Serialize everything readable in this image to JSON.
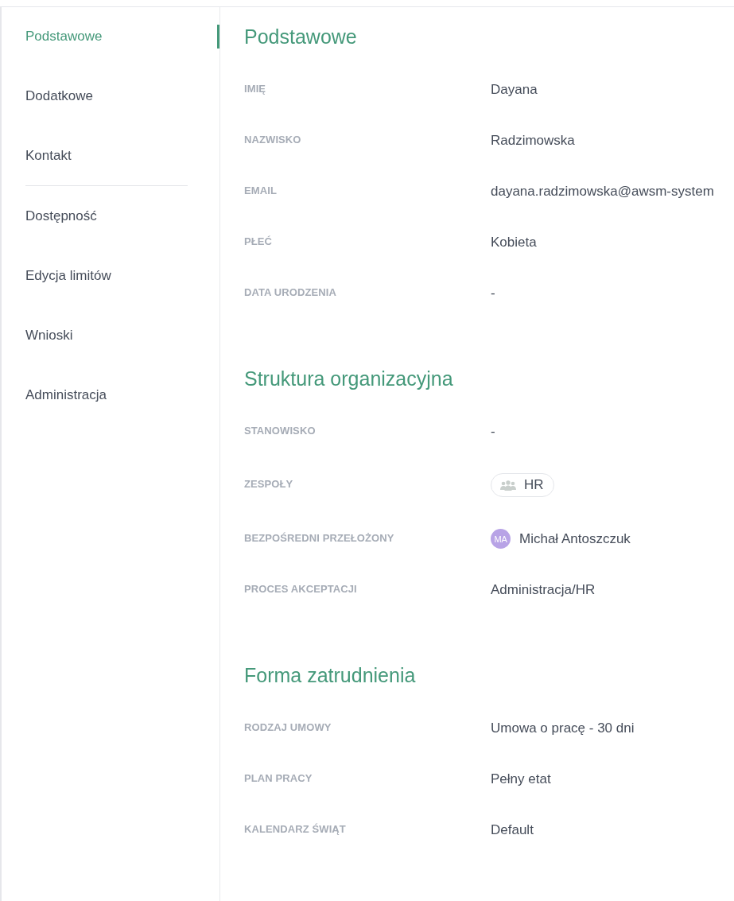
{
  "sidebar": {
    "groups": [
      {
        "items": [
          {
            "label": "Podstawowe",
            "selected": true
          },
          {
            "label": "Dodatkowe",
            "selected": false
          },
          {
            "label": "Kontakt",
            "selected": false
          }
        ]
      },
      {
        "items": [
          {
            "label": "Dostępność",
            "selected": false
          },
          {
            "label": "Edycja limitów",
            "selected": false
          },
          {
            "label": "Wnioski",
            "selected": false
          },
          {
            "label": "Administracja",
            "selected": false
          }
        ]
      }
    ]
  },
  "sections": [
    {
      "title": "Podstawowe",
      "fields": [
        {
          "kind": "text",
          "label": "IMIĘ",
          "value": "Dayana"
        },
        {
          "kind": "text",
          "label": "NAZWISKO",
          "value": "Radzimowska"
        },
        {
          "kind": "text",
          "label": "EMAIL",
          "value": "dayana.radzimowska@awsm-system"
        },
        {
          "kind": "text",
          "label": "PŁEĆ",
          "value": "Kobieta"
        },
        {
          "kind": "text",
          "label": "DATA URODZENIA",
          "value": "-"
        }
      ]
    },
    {
      "title": "Struktura organizacyjna",
      "fields": [
        {
          "kind": "text",
          "label": "STANOWISKO",
          "value": "-"
        },
        {
          "kind": "teams",
          "label": "ZESPOŁY",
          "teams": [
            {
              "name": "HR"
            }
          ]
        },
        {
          "kind": "person",
          "label": "BEZPOŚREDNI PRZEŁOŻONY",
          "initials": "MA",
          "name": "Michał Antoszczuk"
        },
        {
          "kind": "text",
          "label": "PROCES AKCEPTACJI",
          "value": "Administracja/HR"
        }
      ]
    },
    {
      "title": "Forma zatrudnienia",
      "fields": [
        {
          "kind": "text",
          "label": "RODZAJ UMOWY",
          "value": "Umowa o pracę - 30 dni"
        },
        {
          "kind": "text",
          "label": "PLAN PRACY",
          "value": "Pełny etat"
        },
        {
          "kind": "text",
          "label": "KALENDARZ ŚWIĄT",
          "value": "Default"
        }
      ]
    }
  ]
}
